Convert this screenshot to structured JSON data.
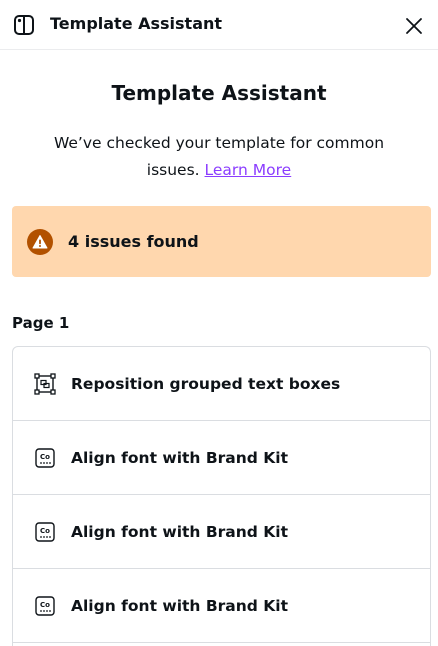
{
  "header": {
    "title": "Template Assistant",
    "icon": "template-assistant-icon",
    "close_icon": "close-icon"
  },
  "panel": {
    "title": "Template Assistant",
    "description": "We’ve checked your template for common issues.",
    "link_label": "Learn More"
  },
  "banner": {
    "text": "4 issues found",
    "icon": "warning-icon",
    "background": "#ffd7ae",
    "icon_color": "#b25100"
  },
  "page_label": "Page 1",
  "issues": [
    {
      "label": "Reposition grouped text boxes",
      "icon": "grouped-text-icon"
    },
    {
      "label": "Align font with Brand Kit",
      "icon": "brand-font-icon"
    },
    {
      "label": "Align font with Brand Kit",
      "icon": "brand-font-icon"
    },
    {
      "label": "Align font with Brand Kit",
      "icon": "brand-font-icon"
    }
  ],
  "colors": {
    "link": "#8b3dff",
    "text": "#0e1318",
    "border": "#dadde1"
  }
}
